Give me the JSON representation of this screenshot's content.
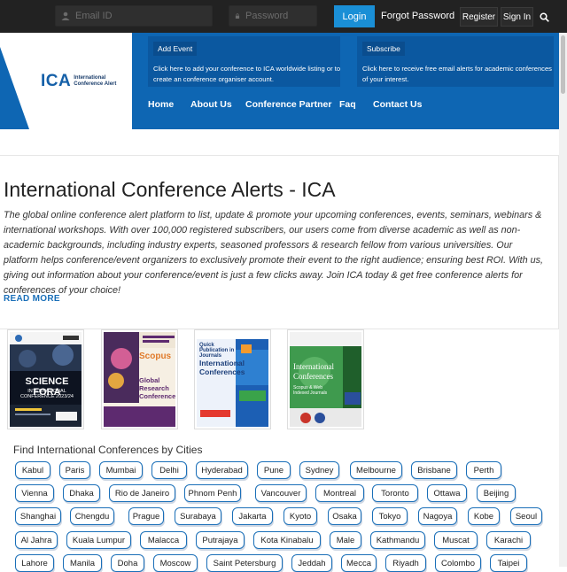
{
  "topbar": {
    "email_placeholder": "Email ID",
    "password_placeholder": "Password",
    "login_label": "Login",
    "forgot_label": "Forgot Password",
    "register_label": "Register",
    "signin_label": "Sign In",
    "search_icon": "search-icon"
  },
  "logo": {
    "main": "ICA",
    "line1": "International",
    "line2": "Conference Alert"
  },
  "promos": [
    {
      "label": "Add Event",
      "text": "Click here to add your conference to ICA worldwide listing or to create an conference organiser account."
    },
    {
      "label": "Subscribe",
      "text": "Click here to receive free email alerts for academic conferences of your interest."
    }
  ],
  "nav": [
    "Home",
    "About Us",
    "Conference Partner",
    "Faq",
    "Contact Us"
  ],
  "main": {
    "title": "International Conference Alerts - ICA",
    "intro": "The global online conference alert platform to list, update & promote your upcoming conferences, events, seminars, webinars & international workshops. With over 100,000 registered subscribers, our users come from diverse academic as well as non-academic backgrounds, including industry experts, seasoned professors & research fellow from various universities. Our platform helps conference/event organizers to exclusively promote their event to the right audience; ensuring best ROI. With us, giving out information about your conference/event is just a few clicks away. Join ICA today & get free conference alerts for conferences of your choice!",
    "read_more": "READ MORE"
  },
  "banners": [
    {
      "title": "SCIENCE FORA",
      "subtitle": "INTERNATIONAL CONFERENCE 2023/24"
    },
    {
      "title": "Scopus",
      "subtitle": "Global Research Conferences"
    },
    {
      "title": "International Conferences",
      "subtitle": "Quick Publication in Journals"
    },
    {
      "title": "International Conferences",
      "subtitle": "Scopus & Web Indexed Journals"
    }
  ],
  "cities_heading": "Find International Conferences by Cities",
  "cities": [
    [
      "Kabul",
      "Paris",
      "Mumbai",
      "Delhi",
      "Hyderabad",
      "Pune",
      "Sydney",
      "Melbourne",
      "Brisbane",
      "Perth"
    ],
    [
      "Vienna",
      "Dhaka",
      "Rio de Janeiro",
      "Phnom Penh",
      "Vancouver",
      "Montreal",
      "Toronto",
      "Ottawa",
      "Beijing"
    ],
    [
      "Shanghai",
      "Chengdu",
      "Prague",
      "Surabaya",
      "Jakarta",
      "Kyoto",
      "Osaka",
      "Tokyo",
      "Nagoya",
      "Kobe",
      "Seoul"
    ],
    [
      "Al Jahra",
      "Kuala Lumpur",
      "Malacca",
      "Putrajaya",
      "Kota Kinabalu",
      "Male",
      "Kathmandu",
      "Muscat",
      "Karachi"
    ],
    [
      "Lahore",
      "Manila",
      "Doha",
      "Moscow",
      "Saint Petersburg",
      "Jeddah",
      "Mecca",
      "Riyadh",
      "Colombo",
      "Taipei"
    ]
  ]
}
